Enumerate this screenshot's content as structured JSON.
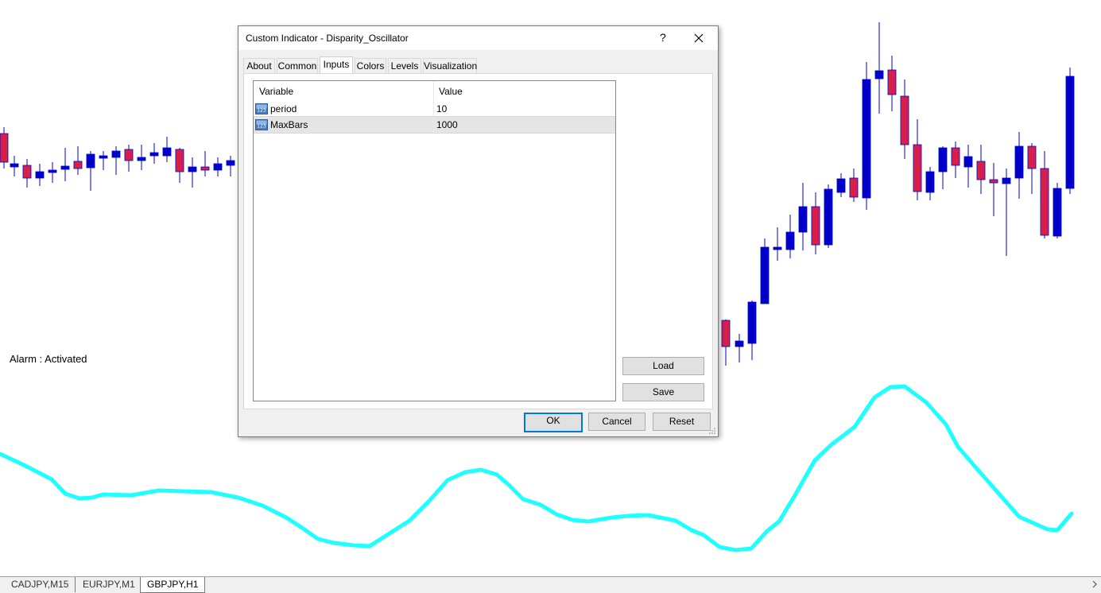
{
  "chart": {
    "candle_up_color": "#0000cc",
    "candle_down_color": "#d6204a",
    "oscillator_color": "#1fffff",
    "alarm_text": "Alarm : Activated"
  },
  "dialog": {
    "title": "Custom Indicator - Disparity_Oscillator",
    "help_label": "?",
    "tabs": [
      {
        "label": "About"
      },
      {
        "label": "Common"
      },
      {
        "label": "Inputs"
      },
      {
        "label": "Colors"
      },
      {
        "label": "Levels"
      },
      {
        "label": "Visualization"
      }
    ],
    "active_tab": "Inputs",
    "table": {
      "headers": {
        "variable": "Variable",
        "value": "Value"
      },
      "rows": [
        {
          "icon": "numeric-icon",
          "icon_text": "123",
          "variable": "period",
          "value": "10"
        },
        {
          "icon": "numeric-icon",
          "icon_text": "123",
          "variable": "MaxBars",
          "value": "1000"
        }
      ]
    },
    "buttons": {
      "load": "Load",
      "save": "Save",
      "ok": "OK",
      "cancel": "Cancel",
      "reset": "Reset"
    }
  },
  "chart_tabs": [
    {
      "label": "CADJPY,M15"
    },
    {
      "label": "EURJPY,M1"
    },
    {
      "label": "GBPJPY,H1",
      "active": true
    }
  ]
}
